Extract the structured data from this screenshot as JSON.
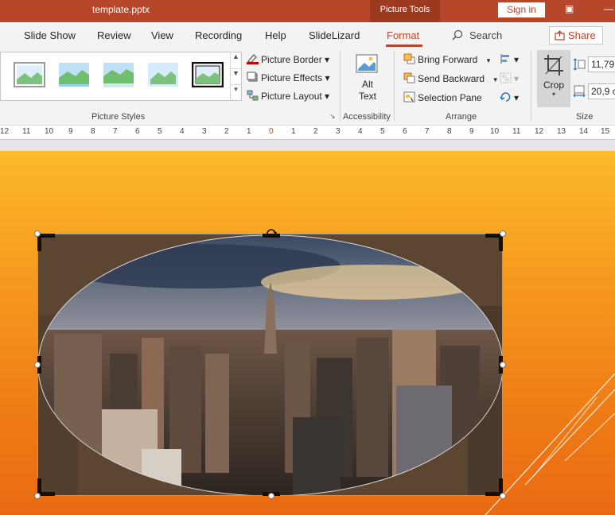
{
  "titlebar": {
    "document": "template.pptx",
    "context_tab": "Picture Tools",
    "sign_in": "Sign in"
  },
  "tabs": [
    {
      "label": "Slide Show"
    },
    {
      "label": "Review"
    },
    {
      "label": "View"
    },
    {
      "label": "Recording"
    },
    {
      "label": "Help"
    },
    {
      "label": "SlideLizard"
    },
    {
      "label": "Format"
    }
  ],
  "search": {
    "label": "Search"
  },
  "share": {
    "label": "Share"
  },
  "ribbon": {
    "picture_styles": {
      "label": "Picture Styles",
      "border": "Picture Border",
      "effects": "Picture Effects",
      "layout": "Picture Layout"
    },
    "accessibility": {
      "label": "Accessibility",
      "alt_text_line1": "Alt",
      "alt_text_line2": "Text"
    },
    "arrange": {
      "label": "Arrange",
      "bring_forward": "Bring Forward",
      "send_backward": "Send Backward",
      "selection_pane": "Selection Pane"
    },
    "size": {
      "label": "Size",
      "crop": "Crop",
      "height_value": "11,79",
      "width_value": "20,9 c"
    }
  },
  "ruler": {
    "ticks": [
      "12",
      "11",
      "10",
      "9",
      "8",
      "7",
      "6",
      "5",
      "4",
      "3",
      "2",
      "1",
      "0",
      "1",
      "2",
      "3",
      "4",
      "5",
      "6",
      "7",
      "8",
      "9",
      "10",
      "11",
      "12",
      "13",
      "14",
      "15"
    ]
  },
  "colors": {
    "accent": "#b7472a",
    "slide_top": "#fdb92c",
    "slide_bottom": "#ea6a12"
  }
}
